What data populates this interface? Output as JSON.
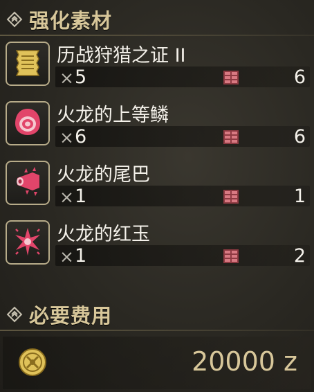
{
  "materials_section": {
    "title": "强化素材",
    "icon": "diamond-badge-icon"
  },
  "materials": [
    {
      "name": "历战狩猎之证 II",
      "qty_prefix": "×",
      "qty": "5",
      "owned": "6",
      "icon": "scroll-icon",
      "icon_color": "#e0c25a"
    },
    {
      "name": "火龙的上等鳞",
      "qty_prefix": "×",
      "qty": "6",
      "owned": "6",
      "icon": "scale-target-icon",
      "icon_color": "#e2456a"
    },
    {
      "name": "火龙的尾巴",
      "qty_prefix": "×",
      "qty": "1",
      "owned": "1",
      "icon": "tail-icon",
      "icon_color": "#e2456a"
    },
    {
      "name": "火龙的红玉",
      "qty_prefix": "×",
      "qty": "1",
      "owned": "2",
      "icon": "gem-star-icon",
      "icon_color": "#e2456a"
    }
  ],
  "cost_section": {
    "title": "必要费用",
    "icon": "diamond-badge-icon",
    "amount": "20000",
    "unit": "z",
    "coin_icon": "coin-icon"
  },
  "colors": {
    "header_text": "#d8c79a",
    "box_icon": "#c0606a",
    "accent_red": "#e2456a",
    "accent_gold": "#e0c25a"
  }
}
